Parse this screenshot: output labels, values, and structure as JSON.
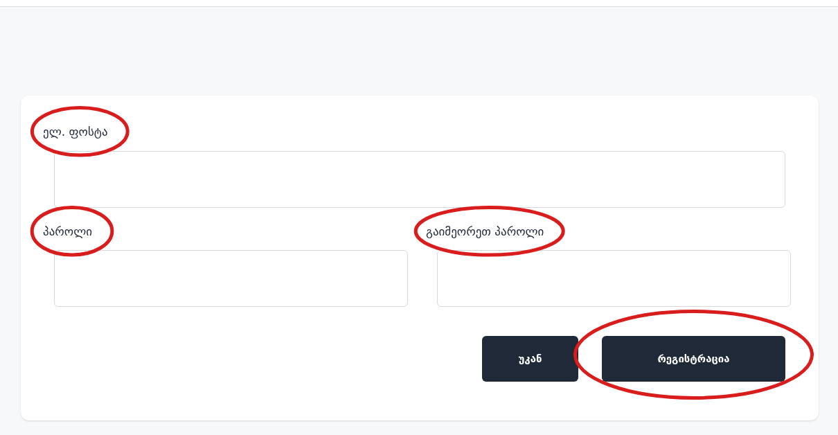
{
  "form": {
    "fields": [
      {
        "label": "ელ. ფოსტა",
        "circled": true,
        "wide": true
      },
      {
        "label": "პაროლი",
        "circled": true,
        "wide": false
      },
      {
        "label": "გაიმეორეთ პაროლი",
        "circled": true,
        "wide": false
      }
    ],
    "buttons": [
      {
        "label": "უკან",
        "circled": false
      },
      {
        "label": "რეგისტრაცია",
        "circled": true
      }
    ]
  }
}
